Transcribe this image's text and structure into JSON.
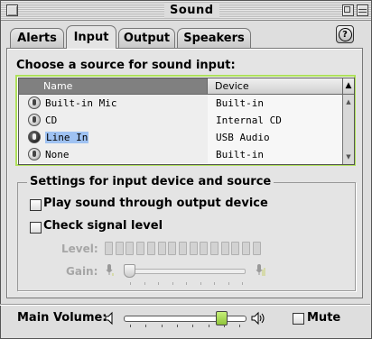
{
  "window": {
    "title": "Sound"
  },
  "tabs": [
    {
      "label": "Alerts",
      "active": false
    },
    {
      "label": "Input",
      "active": true
    },
    {
      "label": "Output",
      "active": false
    },
    {
      "label": "Speakers",
      "active": false
    }
  ],
  "help": {
    "glyph": "?"
  },
  "input_panel": {
    "choose_label": "Choose a source for sound input:",
    "columns": [
      "Name",
      "Device"
    ],
    "sources": [
      {
        "name": "Built-in Mic",
        "device": "Built-in",
        "selected": false
      },
      {
        "name": "CD",
        "device": "Internal CD",
        "selected": false
      },
      {
        "name": "Line In",
        "device": "USB Audio",
        "selected": true
      },
      {
        "name": "None",
        "device": "Built-in",
        "selected": false
      }
    ],
    "settings_label": "Settings for input device and source",
    "play_through_label": "Play sound through output device",
    "play_through_checked": false,
    "check_level_label": "Check signal level",
    "check_level_checked": false,
    "level_label": "Level:",
    "gain_label": "Gain:",
    "gain_value": 0.0
  },
  "footer": {
    "volume_label": "Main Volume:",
    "volume_value": 0.8,
    "mute_label": "Mute",
    "mute_checked": false
  },
  "colors": {
    "accent": "#aee05b",
    "selection": "#9fc2f2",
    "thumb": "#a8d75a"
  }
}
